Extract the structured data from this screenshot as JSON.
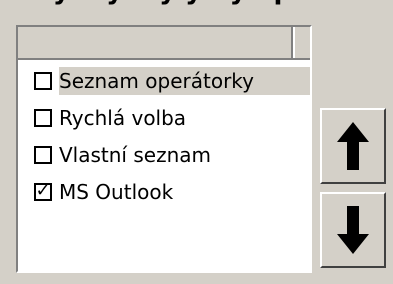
{
  "top_text": "enaybeyeny y ny opne nou",
  "list": {
    "items": [
      {
        "label": "Seznam operátorky",
        "checked": false,
        "selected": true
      },
      {
        "label": "Rychlá volba",
        "checked": false,
        "selected": false
      },
      {
        "label": "Vlastní seznam",
        "checked": false,
        "selected": false
      },
      {
        "label": "MS Outlook",
        "checked": true,
        "selected": false
      }
    ]
  },
  "buttons": {
    "up_icon": "up-arrow-icon",
    "down_icon": "down-arrow-icon"
  }
}
